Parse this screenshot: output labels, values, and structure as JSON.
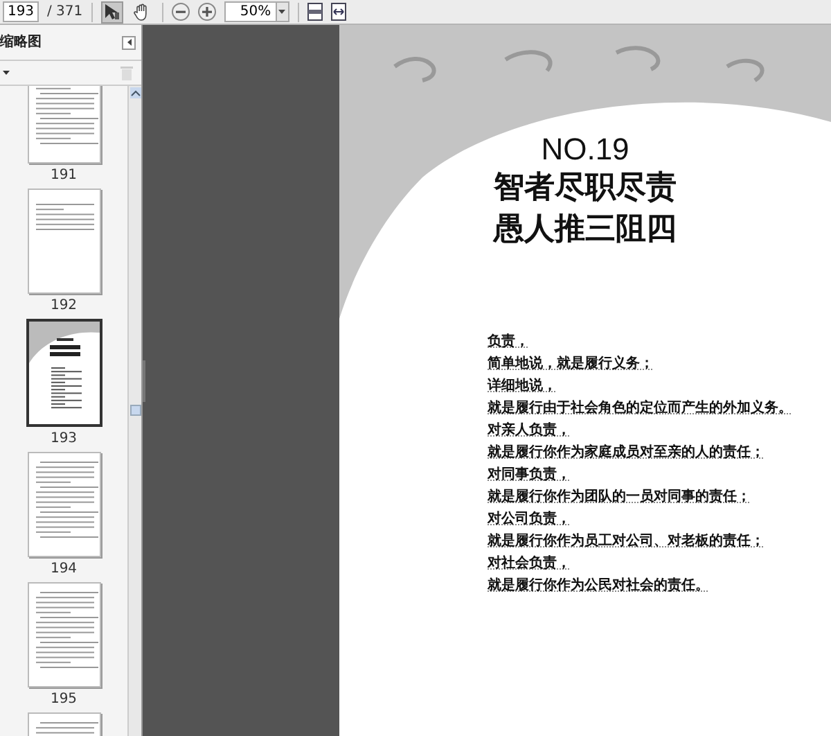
{
  "toolbar": {
    "page_field": {
      "value": "193"
    },
    "page_total": "/ 371",
    "tools": [
      {
        "kind": "select",
        "selected": true
      },
      {
        "kind": "hand",
        "selected": false
      }
    ],
    "zoom_field": {
      "value": "50%"
    }
  },
  "sidebar": {
    "title": "缩略图",
    "thumbnails": [
      {
        "kind": "text",
        "label": "191",
        "selected": false
      },
      {
        "kind": "sparse",
        "label": "192",
        "selected": false
      },
      {
        "kind": "cover",
        "label": "193",
        "selected": true
      },
      {
        "kind": "text",
        "label": "194",
        "selected": false
      },
      {
        "kind": "text",
        "label": "195",
        "selected": false
      },
      {
        "kind": "text",
        "selected": false
      }
    ]
  },
  "page": {
    "number": "NO.19",
    "title_lines": [
      "智者尽职尽责",
      "愚人推三阻四"
    ],
    "body_lines": [
      "负责，",
      "简单地说，就是履行义务；",
      "详细地说，",
      "就是履行由于社会角色的定位而产生的外加义务。",
      "对亲人负责，",
      "就是履行你作为家庭成员对至亲的人的责任；",
      "对同事负责，",
      "就是履行你作为团队的一员对同事的责任；",
      "对公司负责，",
      "就是履行你作为员工对公司、对老板的责任；",
      "对社会负责，",
      "就是履行你作为公民对社会的责任。"
    ]
  }
}
